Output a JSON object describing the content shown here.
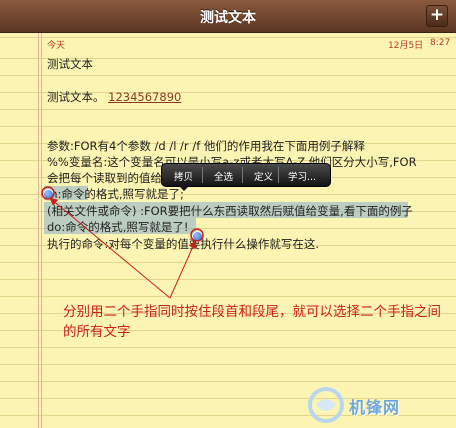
{
  "titlebar": {
    "title": "测试文本",
    "add_icon": "plus-icon",
    "add_label": "+"
  },
  "header": {
    "today": "今天",
    "date": "12月5日",
    "time": "8:27"
  },
  "note": {
    "title": "测试文本",
    "link_prefix": "测试文本。",
    "link": "1234567890",
    "lines": [
      "参数:FOR有4个参数 /d   /l   /r   /f   他们的作用我在下面用例子解释",
      "%%变量名:这个变量名可以是小写a-z或者大写A-Z,他们区分大小写,FOR",
      "会把每个读取到的值给",
      "in:命令的格式,照写就是了;",
      "(相关文件或命令) :FOR要把什么东西读取然后赋值给变量,看下面的例子",
      "do:命令的格式,照写就是了!",
      "执行的命令:对每个变量的值要执行什么操作就写在这."
    ]
  },
  "popup": {
    "copy": "拷贝",
    "select_all": "全选",
    "define": "定义",
    "learn": "学习..."
  },
  "annotation": {
    "text": "分别用二个手指同时按住段首和段尾，就可以选择二个手指之间的所有文字"
  },
  "watermark": {
    "text": "机锋网",
    "icon": "watermark-logo-icon"
  },
  "colors": {
    "titlebar": "#6e432c",
    "paper": "#fcf4b2",
    "selection": "#6ea0d2",
    "annotation": "#c8201c",
    "header_text": "#b73a2a"
  }
}
